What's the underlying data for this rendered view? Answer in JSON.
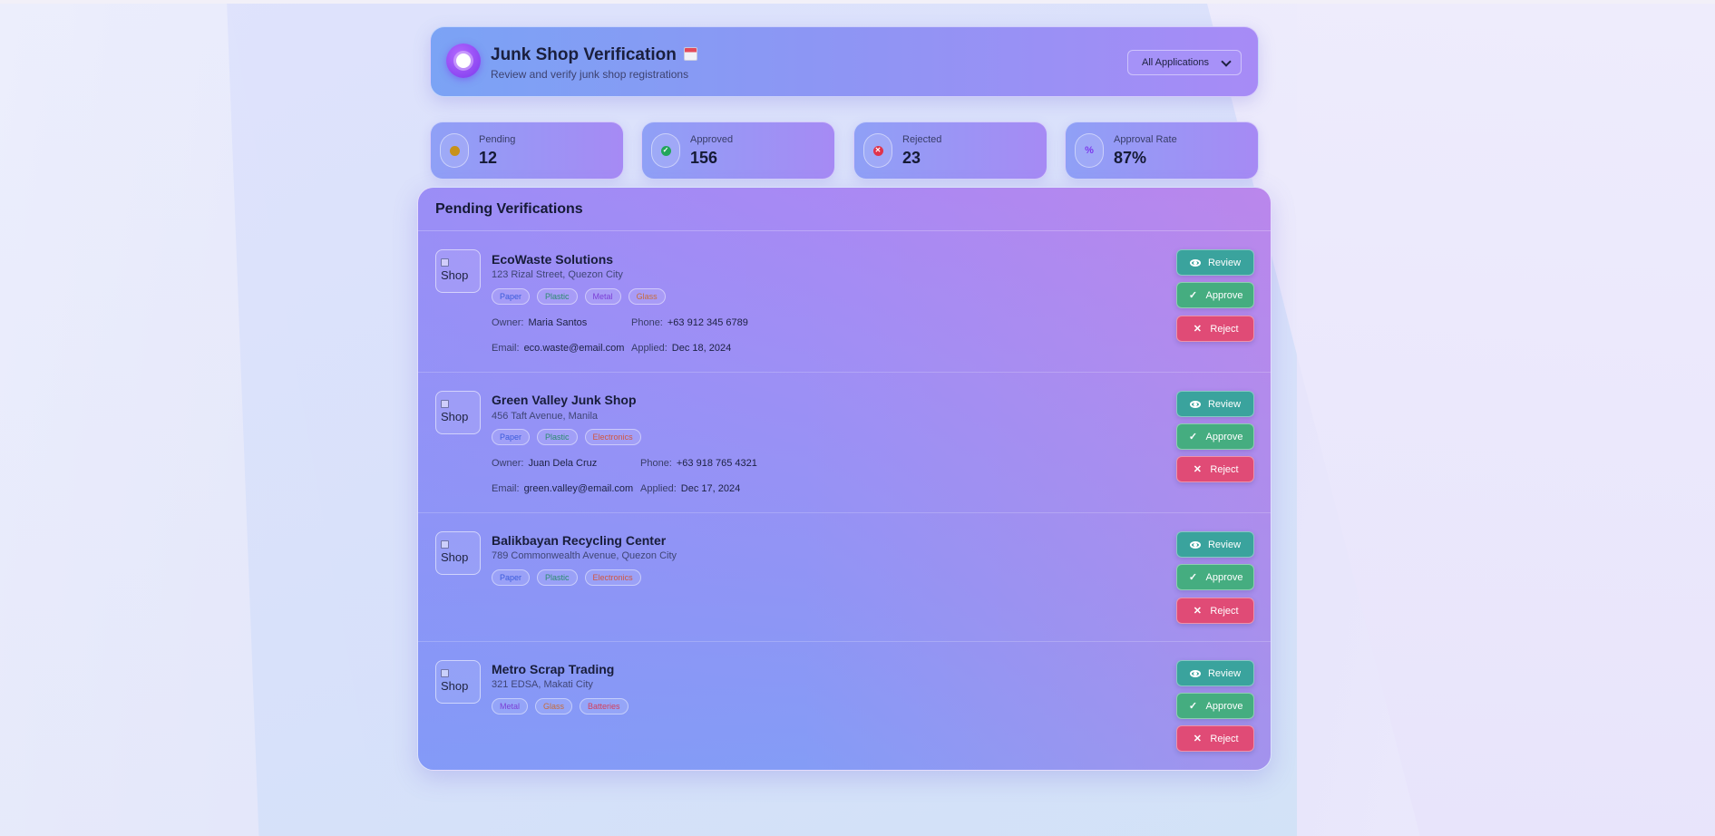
{
  "header": {
    "title": "Junk Shop Verification",
    "subtitle": "Review and verify junk shop registrations",
    "filter_value": "All Applications"
  },
  "stats": [
    {
      "label": "Pending",
      "value": "12",
      "color": "#c8921a"
    },
    {
      "label": "Approved",
      "value": "156",
      "color": "#22a65a"
    },
    {
      "label": "Rejected",
      "value": "23",
      "color": "#e0334a"
    },
    {
      "label": "Approval Rate",
      "value": "87%",
      "color": "#7c3aed"
    }
  ],
  "panel": {
    "title": "Pending Verifications"
  },
  "labels": {
    "owner": "Owner:",
    "phone": "Phone:",
    "email": "Email:",
    "applied": "Applied:",
    "thumb_alt": "Shop"
  },
  "actions": {
    "review": "Review",
    "approve": "Approve",
    "reject": "Reject"
  },
  "shops": [
    {
      "name": "EcoWaste Solutions",
      "address": "123 Rizal Street, Quezon City",
      "tags": [
        {
          "label": "Paper",
          "color": "#3b5bdb"
        },
        {
          "label": "Plastic",
          "color": "#2b8a6e"
        },
        {
          "label": "Metal",
          "color": "#7b3fd6"
        },
        {
          "label": "Glass",
          "color": "#c76b3a"
        }
      ],
      "owner": "Maria Santos",
      "phone": "+63 912 345 6789",
      "email": "eco.waste@email.com",
      "applied": "Dec 18, 2024"
    },
    {
      "name": "Green Valley Junk Shop",
      "address": "456 Taft Avenue, Manila",
      "tags": [
        {
          "label": "Paper",
          "color": "#3b5bdb"
        },
        {
          "label": "Plastic",
          "color": "#2b8a6e"
        },
        {
          "label": "Electronics",
          "color": "#d2553f"
        }
      ],
      "owner": "Juan Dela Cruz",
      "phone": "+63 918 765 4321",
      "email": "green.valley@email.com",
      "applied": "Dec 17, 2024"
    },
    {
      "name": "Balikbayan Recycling Center",
      "address": "789 Commonwealth Avenue, Quezon City",
      "tags": [
        {
          "label": "Paper",
          "color": "#3b5bdb"
        },
        {
          "label": "Plastic",
          "color": "#2b8a6e"
        },
        {
          "label": "Electronics",
          "color": "#d2553f"
        }
      ]
    },
    {
      "name": "Metro Scrap Trading",
      "address": "321 EDSA, Makati City",
      "tags": [
        {
          "label": "Metal",
          "color": "#7b3fd6"
        },
        {
          "label": "Glass",
          "color": "#c76b3a"
        },
        {
          "label": "Batteries",
          "color": "#d43d5a"
        }
      ]
    }
  ]
}
